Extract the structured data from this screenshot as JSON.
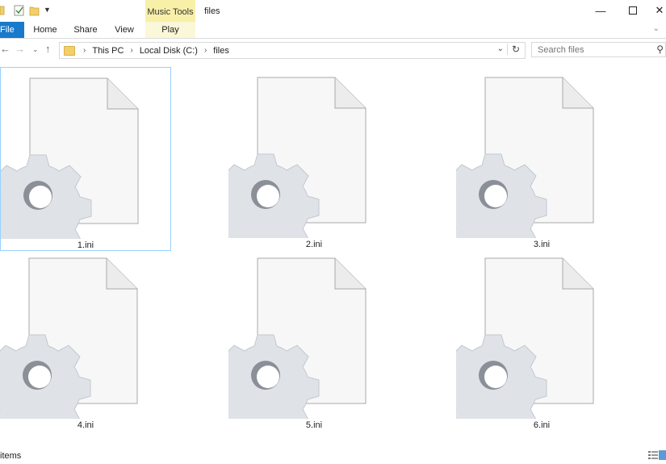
{
  "window": {
    "title": "files",
    "contextual_tab_group": "Music Tools"
  },
  "ribbon": {
    "tabs": [
      {
        "label": "File"
      },
      {
        "label": "Home"
      },
      {
        "label": "Share"
      },
      {
        "label": "View"
      },
      {
        "label": "Play"
      }
    ]
  },
  "address": {
    "crumbs": [
      "This PC",
      "Local Disk (C:)",
      "files"
    ]
  },
  "search": {
    "placeholder": "Search files"
  },
  "files": [
    {
      "name": "1.ini",
      "selected": true
    },
    {
      "name": "2.ini",
      "selected": false
    },
    {
      "name": "3.ini",
      "selected": false
    },
    {
      "name": "4.ini",
      "selected": false
    },
    {
      "name": "5.ini",
      "selected": false
    },
    {
      "name": "6.ini",
      "selected": false
    }
  ],
  "status": {
    "text": "items"
  },
  "colors": {
    "file_tab": "#1979ca",
    "music_tools": "#f8f0a8",
    "selection_border": "#99d1ff"
  }
}
